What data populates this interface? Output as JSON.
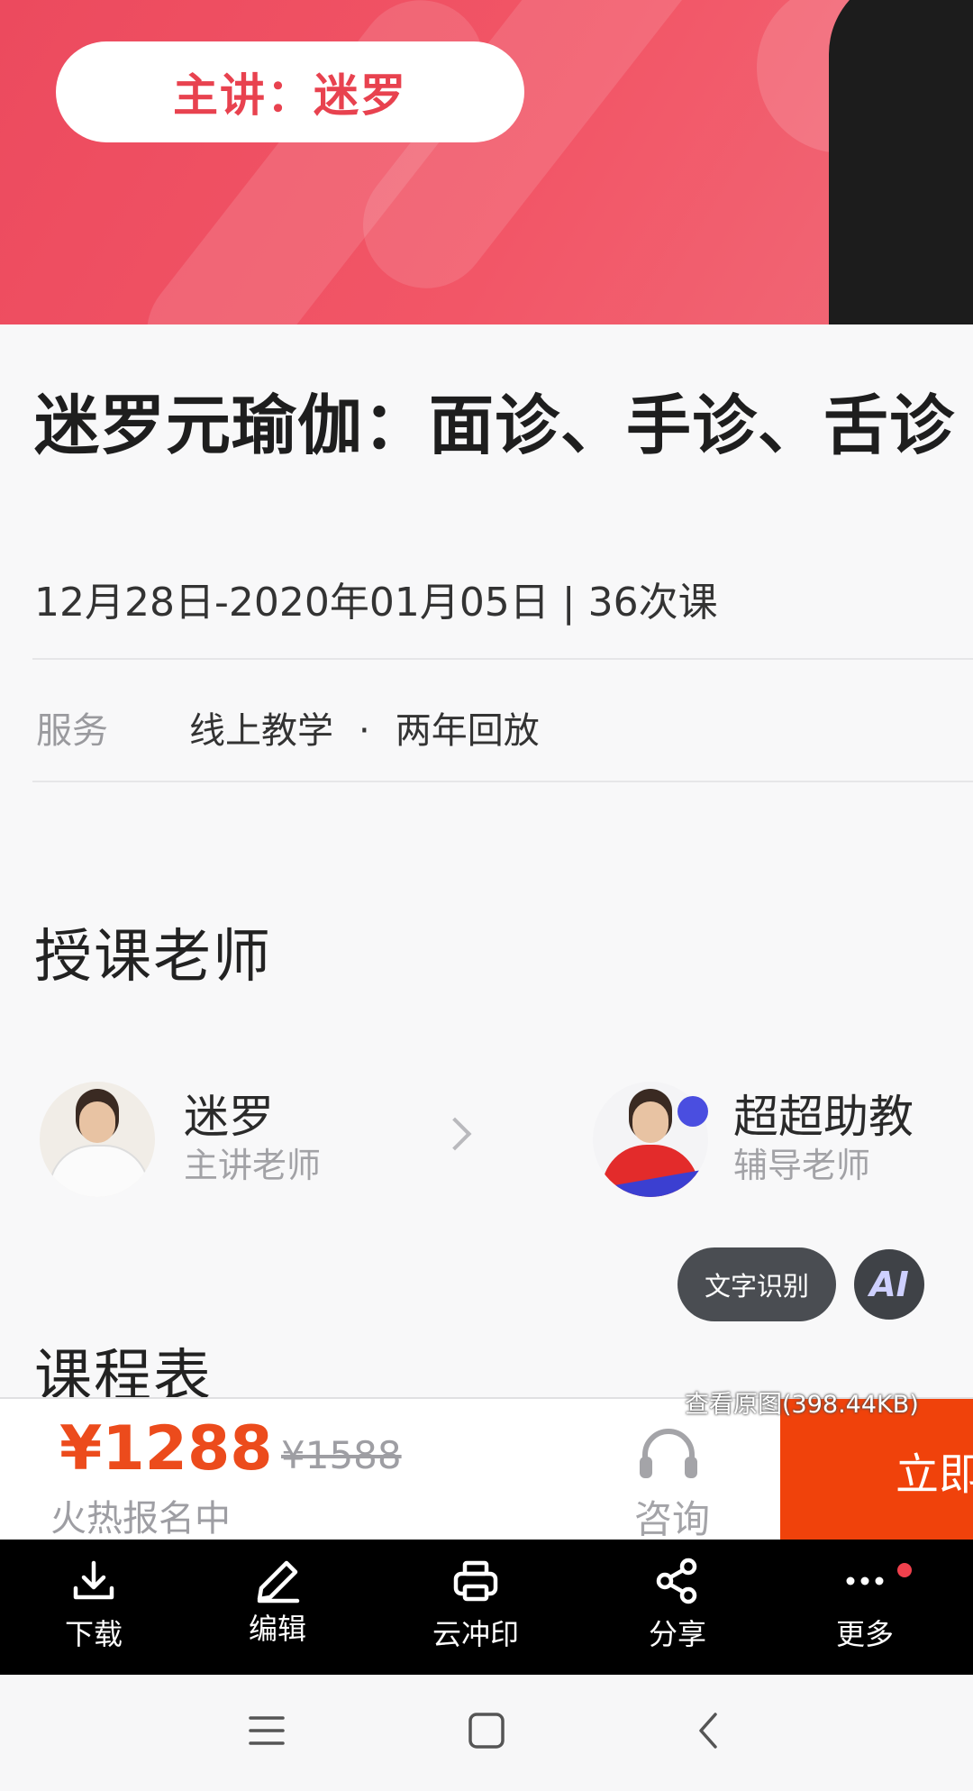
{
  "banner": {
    "speaker": "主讲：迷罗"
  },
  "course": {
    "title": "迷罗元瑜伽：面诊、手诊、舌诊",
    "dates": "12月28日-2020年01月05日 | 36次课",
    "service_label": "服务",
    "services": [
      "线上教学",
      "两年回放"
    ]
  },
  "teachers_section": {
    "title": "授课老师",
    "teachers": [
      {
        "name": "迷罗",
        "role": "主讲老师"
      },
      {
        "name": "超超助教",
        "role": "辅导老师"
      }
    ]
  },
  "schedule_section": {
    "title": "课程表"
  },
  "overlay": {
    "ocr_label": "文字识别",
    "ai_label": "AI",
    "view_original": "查看原图(398.44KB)"
  },
  "purchase": {
    "price": "¥1288",
    "original_price": "¥1588",
    "status": "火热报名中",
    "consult_label": "咨询",
    "enroll_label": "立即",
    "accent_color": "#f0420b"
  },
  "toolbar": {
    "items": [
      {
        "label": "下载",
        "icon": "download-icon"
      },
      {
        "label": "编辑",
        "icon": "pen-icon"
      },
      {
        "label": "云冲印",
        "icon": "printer-icon"
      },
      {
        "label": "分享",
        "icon": "share-icon"
      },
      {
        "label": "更多",
        "icon": "more-icon"
      }
    ]
  },
  "navbar": {
    "icons": [
      "menu-icon",
      "home-icon",
      "back-icon"
    ]
  }
}
